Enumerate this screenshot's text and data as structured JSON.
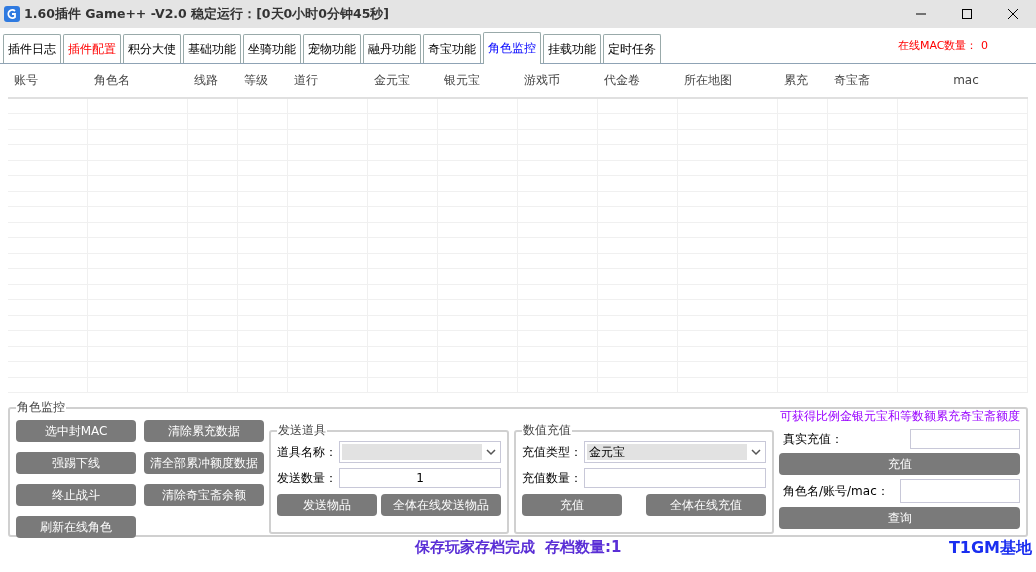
{
  "window": {
    "title": "1.60插件 Game++ -V2.0 稳定运行：[0天0小时0分钟45秒]"
  },
  "tabs": [
    {
      "label": "插件日志",
      "selected": false,
      "kind": "normal"
    },
    {
      "label": "插件配置",
      "selected": false,
      "kind": "alert"
    },
    {
      "label": "积分大使",
      "selected": false,
      "kind": "normal"
    },
    {
      "label": "基础功能",
      "selected": false,
      "kind": "normal"
    },
    {
      "label": "坐骑功能",
      "selected": false,
      "kind": "normal"
    },
    {
      "label": "宠物功能",
      "selected": false,
      "kind": "normal"
    },
    {
      "label": "融丹功能",
      "selected": false,
      "kind": "normal"
    },
    {
      "label": "奇宝功能",
      "selected": false,
      "kind": "normal"
    },
    {
      "label": "角色监控",
      "selected": true,
      "kind": "normal"
    },
    {
      "label": "挂载功能",
      "selected": false,
      "kind": "normal"
    },
    {
      "label": "定时任务",
      "selected": false,
      "kind": "normal"
    }
  ],
  "online_mac": {
    "label": "在线MAC数量：",
    "value": "0"
  },
  "table": {
    "columns": [
      "账号",
      "角色名",
      "线路",
      "等级",
      "道行",
      "金元宝",
      "银元宝",
      "游戏币",
      "代金卷",
      "所在地图",
      "累充",
      "奇宝斋",
      "mac"
    ]
  },
  "monitor_panel": {
    "title": "角色监控",
    "buttons": [
      "选中封MAC",
      "强踢下线",
      "终止战斗",
      "刷新在线角色",
      "清除累充数据",
      "清全部累冲额度数据",
      "清除奇宝斋余额"
    ],
    "send_item": {
      "title": "发送道具",
      "name_label": "道具名称：",
      "count_label": "发送数量：",
      "count_value": "1",
      "buttons": [
        "发送物品",
        "全体在线发送物品"
      ]
    },
    "recharge": {
      "title": "数值充值",
      "type_label": "充值类型：",
      "type_value": "金元宝",
      "amount_label": "充值数量：",
      "buttons": [
        "充值",
        "全体在线充值"
      ]
    },
    "real_recharge": {
      "note": "可获得比例金银元宝和等数额累充奇宝斋额度",
      "label": "真实充值：",
      "button": "充值",
      "query_label": "角色名/账号/mac：",
      "query_button": "查询"
    }
  },
  "status": "保存玩家存档完成  存档数量:1",
  "brand": "T1GM基地"
}
